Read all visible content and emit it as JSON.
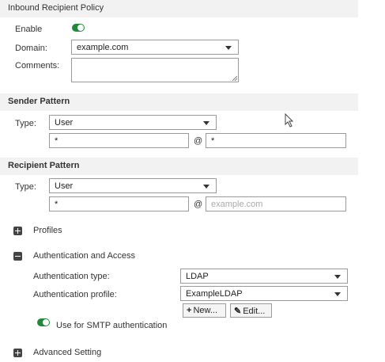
{
  "header": {
    "title": "Inbound Recipient Policy"
  },
  "general": {
    "enable_label": "Enable",
    "domain_label": "Domain:",
    "domain_value": "example.com",
    "comments_label": "Comments:",
    "comments_value": ""
  },
  "sender": {
    "section_title": "Sender Pattern",
    "type_label": "Type:",
    "type_value": "User",
    "user_value": "*",
    "at": "@",
    "domain_value": "*"
  },
  "recipient": {
    "section_title": "Recipient Pattern",
    "type_label": "Type:",
    "type_value": "User",
    "user_value": "*",
    "at": "@",
    "domain_placeholder": "example.com"
  },
  "profiles": {
    "label": "Profiles",
    "icon": "expand-plus-icon"
  },
  "auth": {
    "label": "Authentication and Access",
    "icon": "collapse-minus-icon",
    "type_label": "Authentication type:",
    "type_value": "LDAP",
    "profile_label": "Authentication profile:",
    "profile_value": "ExampleLDAP",
    "new_button": "New...",
    "edit_button": "Edit...",
    "smtp_label": "Use for SMTP authentication"
  },
  "advanced": {
    "label": "Advanced Setting",
    "icon": "expand-plus-icon"
  },
  "colors": {
    "toggle_on": "#1e8a3a",
    "section_band": "#f2f2f2"
  }
}
